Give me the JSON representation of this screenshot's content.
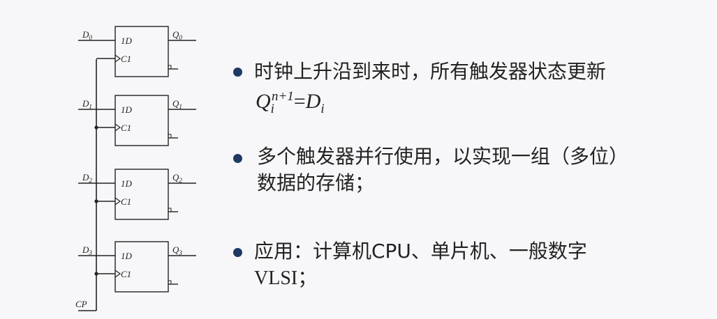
{
  "circuit": {
    "blocks": [
      {
        "d_label": "D",
        "d_sub": "0",
        "q_label": "Q",
        "q_sub": "0",
        "in_label": "1D",
        "clk_label": "C1"
      },
      {
        "d_label": "D",
        "d_sub": "1",
        "q_label": "Q",
        "q_sub": "1",
        "in_label": "1D",
        "clk_label": "C1"
      },
      {
        "d_label": "D",
        "d_sub": "2",
        "q_label": "Q",
        "q_sub": "2",
        "in_label": "1D",
        "clk_label": "C1"
      },
      {
        "d_label": "D",
        "d_sub": "3",
        "q_label": "Q",
        "q_sub": "3",
        "in_label": "1D",
        "clk_label": "C1"
      }
    ],
    "clock_label": "CP"
  },
  "bullets": {
    "b1": {
      "line1": "时钟上升沿到来时，所有触发器状态更新"
    },
    "formula": {
      "q": "Q",
      "q_sub": "i",
      "q_sup": "n+1",
      "eq": "=",
      "d": "D",
      "d_sub": "i"
    },
    "b2": {
      "line1": "多个触发器并行使用，以实现一组（多位）",
      "line2": "数据的存储；"
    },
    "b3": {
      "line1": "应用：计算机CPU、单片机、一般数字",
      "line2": "VLSI；"
    }
  },
  "colors": {
    "bullet": "#1f3864",
    "line": "#222222",
    "text": "#222222"
  }
}
